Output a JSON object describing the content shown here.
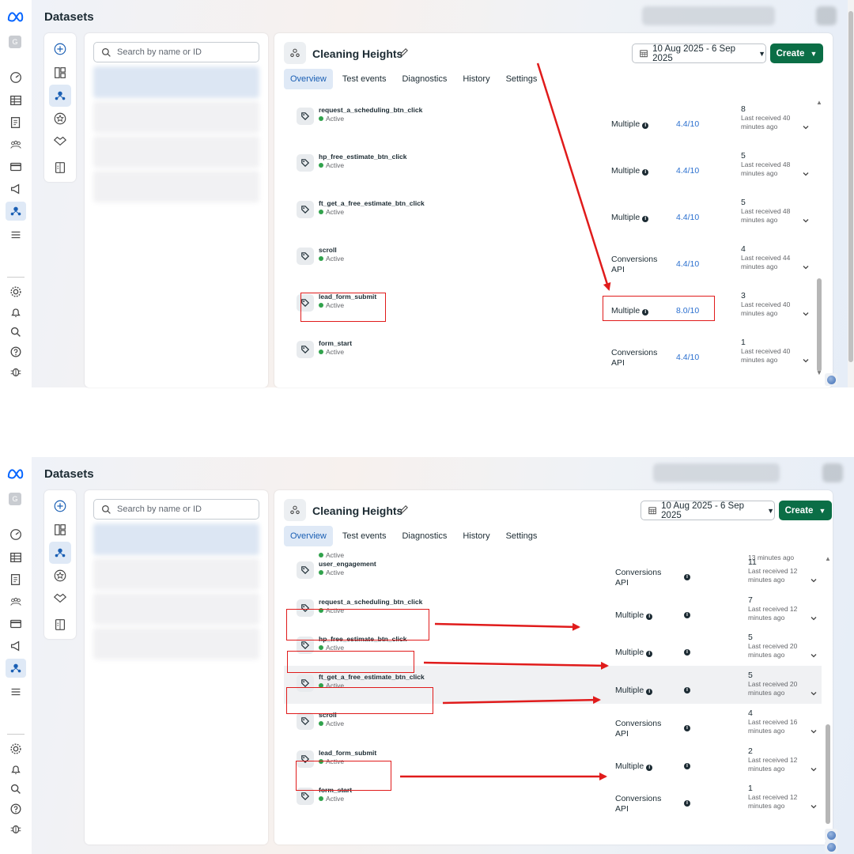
{
  "panels": [
    {
      "app_title": "Datasets",
      "avatar_letter": "G",
      "search": {
        "placeholder": "Search by name or ID"
      },
      "dataset_name": "Cleaning Heights",
      "date_range": "10 Aug 2025 - 6 Sep 2025",
      "create_label": "Create",
      "tabs": [
        "Overview",
        "Test events",
        "Diagnostics",
        "History",
        "Settings"
      ],
      "active_tab": "Overview",
      "events": [
        {
          "name": "request_a_scheduling_btn_click",
          "status": "Active",
          "method": "Multiple",
          "score": "4.4/10",
          "count": "8",
          "last_received": "Last received 40 minutes ago"
        },
        {
          "name": "hp_free_estimate_btn_click",
          "status": "Active",
          "method": "Multiple",
          "score": "4.4/10",
          "count": "5",
          "last_received": "Last received 48 minutes ago"
        },
        {
          "name": "ft_get_a_free_estimate_btn_click",
          "status": "Active",
          "method": "Multiple",
          "score": "4.4/10",
          "count": "5",
          "last_received": "Last received 48 minutes ago"
        },
        {
          "name": "scroll",
          "status": "Active",
          "method": "Conversions API",
          "score": "4.4/10",
          "count": "4",
          "last_received": "Last received 44 minutes ago"
        },
        {
          "name": "lead_form_submit",
          "status": "Active",
          "method": "Multiple",
          "score": "8.0/10",
          "count": "3",
          "last_received": "Last received 40 minutes ago"
        },
        {
          "name": "form_start",
          "status": "Active",
          "method": "Conversions API",
          "score": "4.4/10",
          "count": "1",
          "last_received": "Last received 40 minutes ago"
        }
      ]
    },
    {
      "app_title": "Datasets",
      "avatar_letter": "G",
      "search": {
        "placeholder": "Search by name or ID"
      },
      "dataset_name": "Cleaning Heights",
      "date_range": "10 Aug 2025 - 6 Sep 2025",
      "create_label": "Create",
      "tabs": [
        "Overview",
        "Test events",
        "Diagnostics",
        "History",
        "Settings"
      ],
      "active_tab": "Overview",
      "partial_row": {
        "status": "Active",
        "last_received": "13 minutes ago"
      },
      "events": [
        {
          "name": "user_engagement",
          "status": "Active",
          "method": "Conversions API",
          "count": "11",
          "last_received": "Last received 12 minutes ago"
        },
        {
          "name": "request_a_scheduling_btn_click",
          "status": "Active",
          "method": "Multiple",
          "count": "7",
          "last_received": "Last received 12 minutes ago"
        },
        {
          "name": "hp_free_estimate_btn_click",
          "status": "Active",
          "method": "Multiple",
          "count": "5",
          "last_received": "Last received 20 minutes ago"
        },
        {
          "name": "ft_get_a_free_estimate_btn_click",
          "status": "Active",
          "method": "Multiple",
          "count": "5",
          "last_received": "Last received 20 minutes ago"
        },
        {
          "name": "scroll",
          "status": "Active",
          "method": "Conversions API",
          "count": "4",
          "last_received": "Last received 16 minutes ago"
        },
        {
          "name": "lead_form_submit",
          "status": "Active",
          "method": "Multiple",
          "count": "2",
          "last_received": "Last received 12 minutes ago"
        },
        {
          "name": "form_start",
          "status": "Active",
          "method": "Conversions API",
          "count": "1",
          "last_received": "Last received 12 minutes ago"
        }
      ]
    }
  ],
  "icons": {
    "status_active": "#31a24c",
    "create_button": "#0b6e46",
    "accent": "#1a5fb4",
    "annotation": "#e01b1b"
  }
}
